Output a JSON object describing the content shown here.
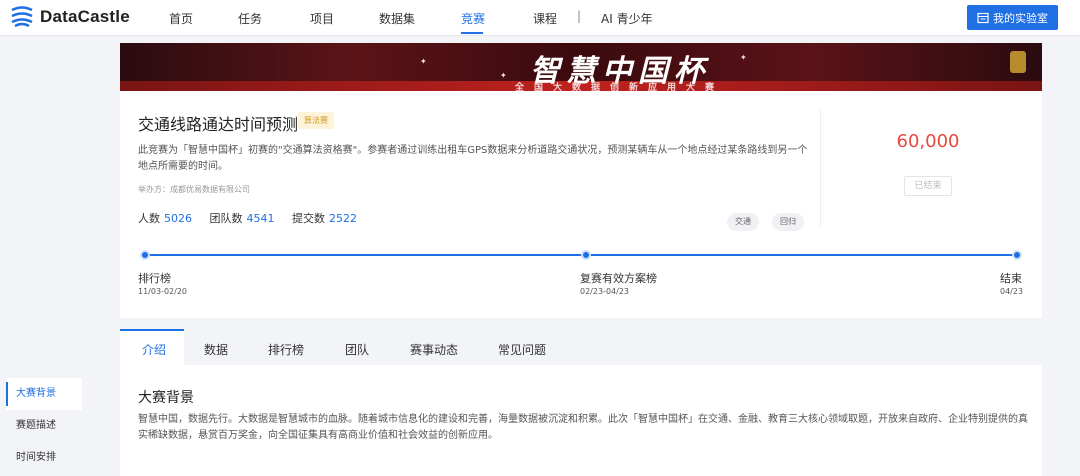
{
  "brand": {
    "name": "DataCastle"
  },
  "nav": {
    "items": [
      {
        "label": "首页"
      },
      {
        "label": "任务"
      },
      {
        "label": "项目"
      },
      {
        "label": "数据集"
      },
      {
        "label": "竞赛"
      },
      {
        "label": "课程"
      },
      {
        "label": "AI 青少年"
      }
    ],
    "separator": "|",
    "active": "竞赛",
    "lab_button": "我的实验室"
  },
  "banner": {
    "title": "智慧中国杯",
    "subtitle": "全国大数据创新应用大赛"
  },
  "competition": {
    "title": "交通线路通达时间预测",
    "tag": "算法赛",
    "description": "此竞赛为「智慧中国杯」初赛的\"交通算法资格赛\"。参赛者通过训练出租车GPS数据来分析道路交通状况，预测某辆车从一个地点经过某条路线到另一个地点所需要的时间。",
    "organizer": "举办方：成都优易数据有限公司",
    "stats": [
      {
        "label": "人数",
        "value": "5026"
      },
      {
        "label": "团队数",
        "value": "4541"
      },
      {
        "label": "提交数",
        "value": "2522"
      }
    ],
    "keywords": [
      "交通",
      "回归"
    ],
    "prize": "60,000",
    "status": "已结束"
  },
  "timeline": [
    {
      "label": "排行榜",
      "date": "11/03-02/20"
    },
    {
      "label": "复赛有效方案榜",
      "date": "02/23-04/23"
    },
    {
      "label": "结束",
      "date": "04/23"
    }
  ],
  "tabs": [
    {
      "label": "介绍"
    },
    {
      "label": "数据"
    },
    {
      "label": "排行榜"
    },
    {
      "label": "团队"
    },
    {
      "label": "赛事动态"
    },
    {
      "label": "常见问题"
    }
  ],
  "active_tab": "介绍",
  "section": {
    "title": "大赛背景",
    "text": "智慧中国，数据先行。大数据是智慧城市的血脉。随着城市信息化的建设和完善，海量数据被沉淀和积累。此次「智慧中国杯」在交通、金融、教育三大核心领域取题，开放来自政府、企业特别提供的真实稀缺数据，悬赏百万奖金，向全国征集具有高商业价值和社会效益的创新应用。"
  },
  "sidenav": {
    "items": [
      {
        "label": "大赛背景"
      },
      {
        "label": "赛题描述"
      },
      {
        "label": "时间安排"
      }
    ],
    "active": "大赛背景"
  },
  "colors": {
    "accent": "#1f6fe5",
    "prize": "#e8483f",
    "tag_bg": "#fdf3d8",
    "tag_text": "#d69a1f",
    "banner_dark": "#3a0a0e"
  }
}
